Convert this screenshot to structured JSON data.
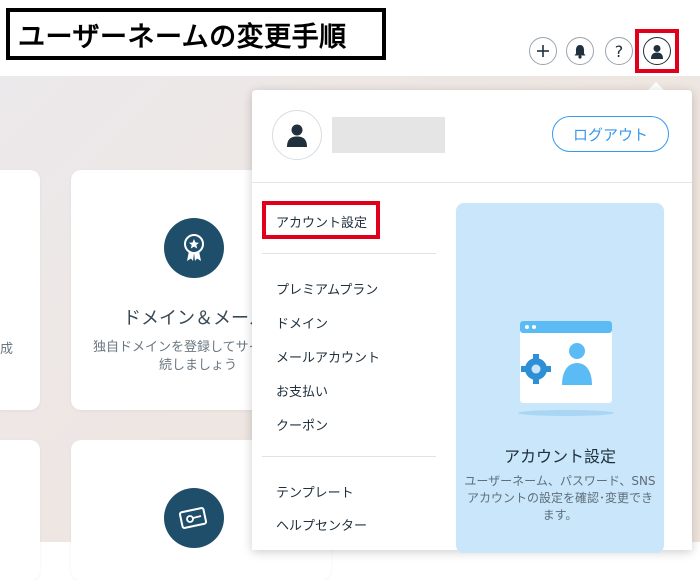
{
  "banner": {
    "title": "ユーザーネームの変更手順"
  },
  "header": {
    "icons": [
      "plus-icon",
      "bell-icon",
      "help-icon",
      "user-icon"
    ],
    "help_label": "?"
  },
  "cards": [
    {
      "id": "left",
      "desc_fragment": "成"
    },
    {
      "id": "domain",
      "title": "ドメイン＆メール",
      "desc_line1": "独自ドメインを登録してサイ",
      "desc_line2": "続しましょう",
      "icon": "award-ribbon-icon"
    },
    {
      "id": "bottom",
      "icon": "key-card-icon"
    }
  ],
  "dropdown": {
    "logout_label": "ログアウト",
    "menu_group1": [
      "アカウント設定"
    ],
    "menu_group2": [
      "プレミアムプラン",
      "ドメイン",
      "メールアカウント",
      "お支払い",
      "クーポン"
    ],
    "menu_group3": [
      "テンプレート",
      "ヘルプセンター"
    ],
    "promo": {
      "title": "アカウント設定",
      "desc": "ユーザーネーム、パスワード、SNSアカウントの設定を確認･変更できます。"
    }
  },
  "colors": {
    "accent": "#3899ec",
    "highlight": "#e0001b",
    "promo_bg": "#c9e6fb",
    "dark_circle": "#1f4e6b"
  }
}
